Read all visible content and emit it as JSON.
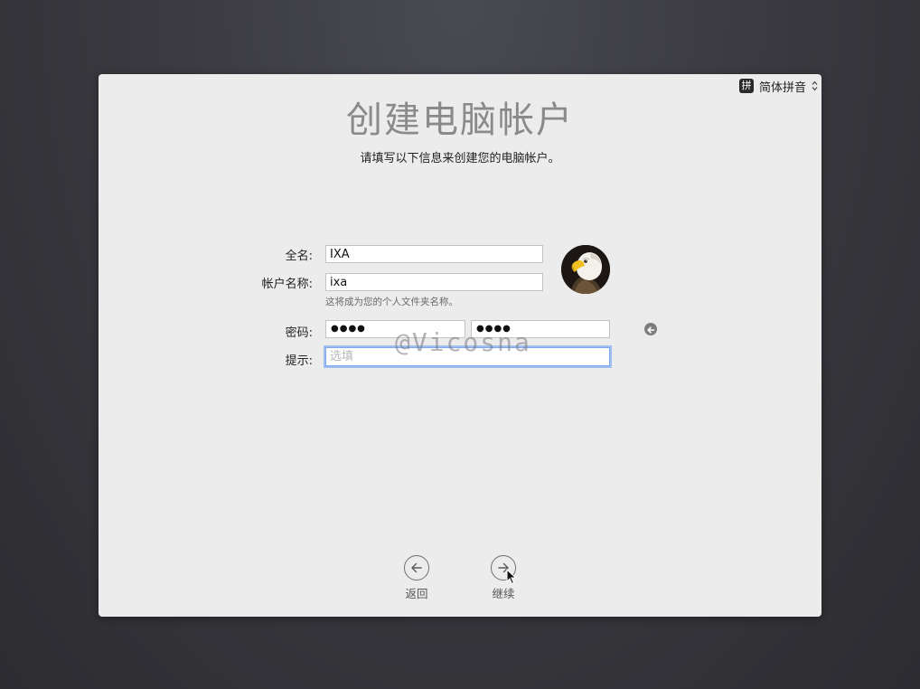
{
  "input_source": {
    "badge": "拼",
    "label": "简体拼音"
  },
  "header": {
    "title": "创建电脑帐户",
    "subtitle": "请填写以下信息来创建您的电脑帐户。"
  },
  "form": {
    "full_name_label": "全名:",
    "full_name_value": "IXA",
    "account_name_label": "帐户名称:",
    "account_name_value": "ixa",
    "account_name_help": "这将成为您的个人文件夹名称。",
    "password_label": "密码:",
    "password_mask": "●●●●",
    "verify_mask": "●●●●",
    "hint_label": "提示:",
    "hint_placeholder": "选填"
  },
  "watermark": "@Vicosna",
  "nav": {
    "back_label": "返回",
    "continue_label": "继续"
  },
  "colors": {
    "accent_focus": "#7fa6e8",
    "panel_bg": "#ececec"
  }
}
